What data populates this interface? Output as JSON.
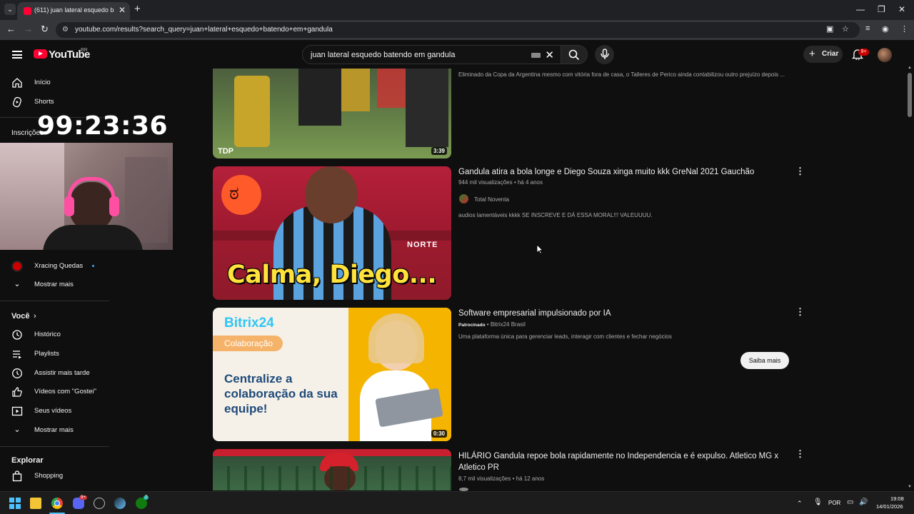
{
  "browser": {
    "tab_title": "(611) juan lateral esquedo bate",
    "url": "youtube.com/results?search_query=juan+lateral+esquedo+batendo+em+gandula"
  },
  "header": {
    "logo_text": "YouTube",
    "country_code": "BR",
    "search_query": "juan lateral esquedo batendo em gandula",
    "create_label": "Criar",
    "notifications_badge": "9+"
  },
  "overlay": {
    "timer": "99:23:36"
  },
  "sidebar": {
    "home": "Início",
    "shorts": "Shorts",
    "subscriptions_heading": "Inscrições",
    "sub_channel": "Xracing Quedas",
    "show_more_1": "Mostrar mais",
    "you_heading": "Você",
    "history": "Histórico",
    "playlists": "Playlists",
    "watch_later": "Assistir mais tarde",
    "liked": "Vídeos com \"Gostei\"",
    "your_videos": "Seus vídeos",
    "show_more_2": "Mostrar mais",
    "explore_heading": "Explorar",
    "shopping": "Shopping"
  },
  "results": [
    {
      "description": "Eliminado da Copa da Argentina mesmo com vitória fora de casa, o Talleres de Perico ainda contabilizou outro prejuízo depois ...",
      "thumb_badge": "TDP",
      "duration": "3:39"
    },
    {
      "title": "Gandula atira a bola longe e Diego Souza xinga muito kkk GreNal 2021 Gauchão",
      "views": "944 mil visualizações",
      "age": "há 4 anos",
      "channel": "Total Noventa",
      "description": "audios lamentáveis kkkk SE INSCREVE E DÁ ESSA MORAL!!! VALEUUUU.",
      "thumb_text": "Calma, Diego...",
      "thumb_banner": "NORTE"
    },
    {
      "title": "Software empresarial impulsionado por IA",
      "sponsored_label": "Patrocinado",
      "channel": "Bitrix24 Brasil",
      "description": "Uma plataforma única para gerenciar leads, interagir com clientes e fechar negócios",
      "cta": "Saiba mais",
      "ad_brand": "Bitrix24",
      "ad_tag": "Colaboração",
      "ad_headline": "Centralize a colaboração da sua equipe!",
      "duration": "0:30"
    },
    {
      "title": "HILÁRIO Gandula repoe bola rapidamente no Independencia e é expulso. Atletico MG x Atletico PR",
      "views": "8,7 mil visualizações",
      "age": "há 12 anos"
    }
  ],
  "taskbar": {
    "language": "POR",
    "time": "19:08",
    "date": "14/01/2026",
    "discord_badge": "9+",
    "xbox_badge": "7"
  }
}
